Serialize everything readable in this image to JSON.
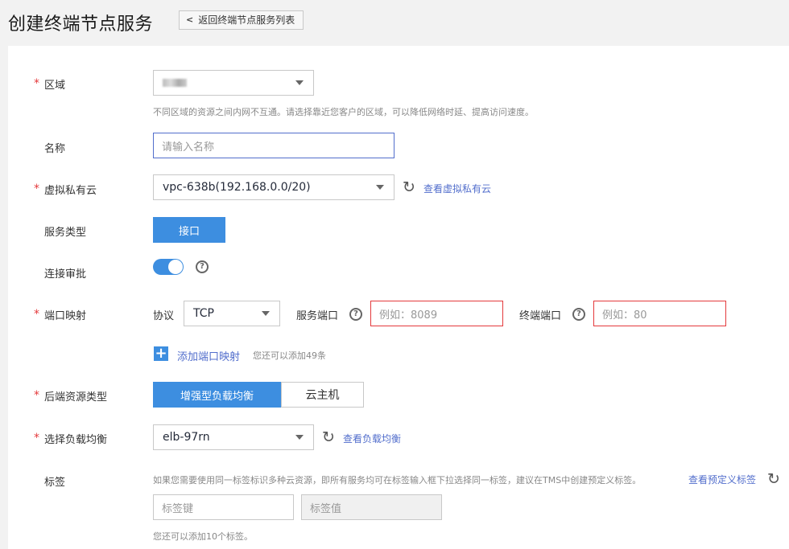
{
  "header": {
    "title": "创建终端节点服务",
    "back_label": "返回终端节点服务列表"
  },
  "form": {
    "region": {
      "label": "区域",
      "value": "",
      "hint": "不同区域的资源之间内网不互通。请选择靠近您客户的区域，可以降低网络时延、提高访问速度。"
    },
    "name": {
      "label": "名称",
      "placeholder": "请输入名称"
    },
    "vpc": {
      "label": "虚拟私有云",
      "value": "vpc-638b(192.168.0.0/20)",
      "link": "查看虚拟私有云"
    },
    "service_type": {
      "label": "服务类型",
      "option": "接口"
    },
    "approval": {
      "label": "连接审批",
      "enabled": true
    },
    "port_mapping": {
      "label": "端口映射",
      "protocol_label": "协议",
      "protocol_value": "TCP",
      "service_port_label": "服务端口",
      "service_port_placeholder": "例如：8089",
      "terminal_port_label": "终端端口",
      "terminal_port_placeholder": "例如：80",
      "add_label": "添加端口映射",
      "add_hint": "您还可以添加49条"
    },
    "backend_type": {
      "label": "后端资源类型",
      "options": [
        "增强型负载均衡",
        "云主机"
      ],
      "selected": "增强型负载均衡"
    },
    "elb": {
      "label": "选择负载均衡",
      "value": "elb-97rn",
      "link": "查看负载均衡"
    },
    "tags": {
      "label": "标签",
      "hint": "如果您需要使用同一标签标识多种云资源，即所有服务均可在标签输入框下拉选择同一标签，建议在TMS中创建预定义标签。",
      "link": "查看预定义标签",
      "key_placeholder": "标签键",
      "value_placeholder": "标签值",
      "count_hint": "您还可以添加10个标签。"
    }
  },
  "colors": {
    "primary": "#3d8ee0",
    "link": "#526ecc",
    "required": "#e4393c"
  }
}
